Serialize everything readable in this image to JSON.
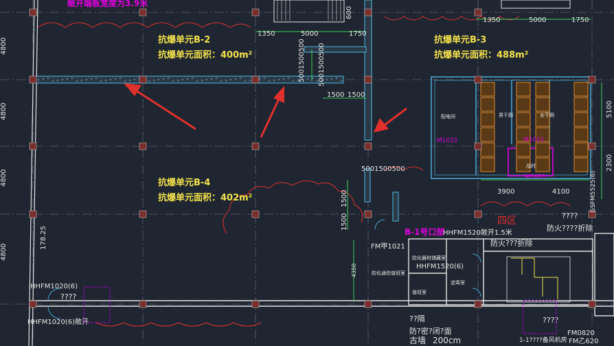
{
  "colors": {
    "background": "#1f2631",
    "grid": "#5a6270",
    "wall": "#4aa3c8",
    "red": "#e0302e",
    "yellow": "#f2e14c",
    "white": "#e6e6e6",
    "magenta": "#e000e0",
    "green": "#3fcf5a",
    "orange": "#e08a2a"
  },
  "top_note": "敞开端板宽度为3.9米",
  "units": {
    "b2": {
      "name": "抗爆单元B-2",
      "area": "抗爆单元面积：400m²"
    },
    "b3": {
      "name": "抗爆单元B-3",
      "area": "抗爆单元面积：488m²"
    },
    "b4": {
      "name": "抗爆单元B-4",
      "area": "抗爆单元面积：402m²"
    }
  },
  "dims": {
    "top_left": [
      "1350",
      "5000",
      "1750"
    ],
    "top_right": [
      "1350",
      "5000",
      "1750"
    ],
    "vert_600": "600",
    "vert_stack_1": "5001500500",
    "vert_stack_2": "5001500500",
    "mid_pair": [
      "1500",
      "1500"
    ],
    "stack_mid": "5001500500",
    "left_1500_a": "1500",
    "left_1500_b": "1500",
    "room_dims": [
      "3900",
      "4100"
    ],
    "right_side": [
      "5100",
      "2300"
    ],
    "vert_4350": "4350",
    "left_axis": [
      "4800",
      "4800",
      "4800",
      "4800"
    ],
    "axis_178": "178.25"
  },
  "labels": {
    "door_b1": "B-1号口部",
    "hhfm_top": "HHFM1520敞开1.5米",
    "zone": "四区",
    "fire_right": "防火????折除",
    "fire_mid": "防火???折除",
    "fmf1021": "FM甲1021",
    "hhfm1520_6": "HHFM1520(6)",
    "hhfm1020_6": "HHFM1020(6)",
    "hhfm1020_6b": "HHFM1020(6)敞开",
    "qqq1": "????",
    "qqq2": "????",
    "qqq3": "????",
    "m1021a": "M1021",
    "m1021b": "M1021",
    "m1021c": "M1021",
    "gsfm": "GSFM5525(6)",
    "fm0820": "FM0820",
    "fmb620": "FM乙620",
    "bottom_qq": "??隔",
    "bottom_qq2": "防?密?闭?面",
    "bottom_gu": "古墙",
    "bottom_200": "200cm",
    "bottom_right": "1-1????备风机房",
    "mini_room_1": "配电间",
    "mini_room_2": "男干厕",
    "mini_room_3": "女干厕",
    "mini_room_4": "战时",
    "mini_room_5": "防化器材储藏室",
    "mini_room_6": "值班室",
    "mini_room_7": "滤毒室",
    "mini_room_8": "防化通信值班室"
  }
}
